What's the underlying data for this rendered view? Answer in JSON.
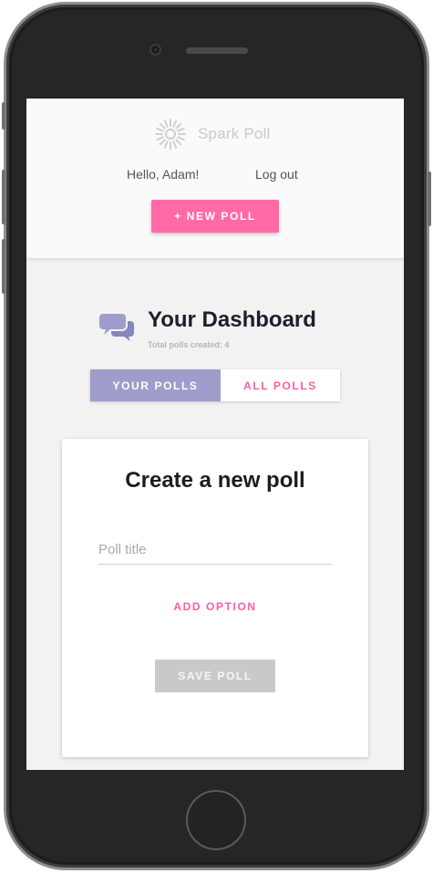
{
  "header": {
    "brand_name": "Spark Poll",
    "greeting": "Hello, Adam!",
    "logout_label": "Log out",
    "new_poll_label": "+ NEW POLL"
  },
  "dashboard": {
    "title": "Your Dashboard",
    "subtitle": "Total polls created: 4",
    "icon": "chat-bubbles-icon"
  },
  "tabs": [
    {
      "label": "YOUR POLLS",
      "active": true
    },
    {
      "label": "ALL POLLS",
      "active": false
    }
  ],
  "create_poll": {
    "title": "Create a new poll",
    "title_placeholder": "Poll title",
    "title_value": "",
    "add_option_label": "ADD OPTION",
    "save_label": "SAVE POLL"
  },
  "colors": {
    "accent_pink": "#ff6aa7",
    "tab_active": "#9f9dcc",
    "save_disabled": "#c9c9cc"
  },
  "icons": {
    "brand": "sunburst-logo-icon",
    "dashboard": "chat-bubbles-icon"
  }
}
